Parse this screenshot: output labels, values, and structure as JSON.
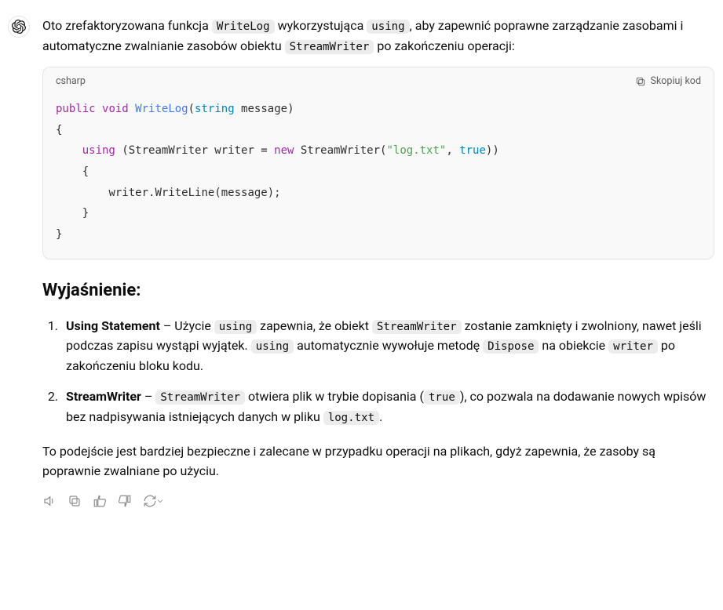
{
  "intro": {
    "t1": "Oto zrefaktoryzowana funkcja ",
    "c1": "WriteLog",
    "t2": " wykorzystująca ",
    "c2": "using",
    "t3": ", aby zapewnić poprawne zarządzanie zasobami i automatyczne zwalnianie zasobów obiektu ",
    "c3": "StreamWriter",
    "t4": " po zakończeniu operacji:"
  },
  "code": {
    "lang": "csharp",
    "copy_label": "Skopiuj kod",
    "tokens": {
      "public": "public",
      "void": "void",
      "fn": "WriteLog",
      "lp": "(",
      "string": "string",
      "arg": " message",
      "rp": ")",
      "ob": "{",
      "using": "using",
      "lp2": " (StreamWriter writer = ",
      "new": "new",
      "ctor": " StreamWriter(",
      "str": "\"log.txt\"",
      "comma": ", ",
      "true": "true",
      "rp2": "))",
      "ob2": "{",
      "line": "writer.WriteLine(message);",
      "cb2": "}",
      "cb": "}"
    }
  },
  "section_heading": "Wyjaśnienie:",
  "item1": {
    "title": "Using Statement",
    "dash": " – Użycie ",
    "c1": "using",
    "t1": " zapewnia, że obiekt ",
    "c2": "StreamWriter",
    "t2": " zostanie zamknięty i zwolniony, nawet jeśli podczas zapisu wystąpi wyjątek. ",
    "c3": "using",
    "t3": " automatycznie wywołuje metodę ",
    "c4": "Dispose",
    "t4": " na obiekcie ",
    "c5": "writer",
    "t5": " po zakończeniu bloku kodu."
  },
  "item2": {
    "title": "StreamWriter",
    "dash": " – ",
    "c1": "StreamWriter",
    "t1": " otwiera plik w trybie dopisania (",
    "c2": "true",
    "t2": "), co pozwala na dodawanie nowych wpisów bez nadpisywania istniejących danych w pliku ",
    "c3": "log.txt",
    "t3": "."
  },
  "conclusion": "To podejście jest bardziej bezpieczne i zalecane w przypadku operacji na plikach, gdyż zapewnia, że zasoby są poprawnie zwalniane po użyciu."
}
